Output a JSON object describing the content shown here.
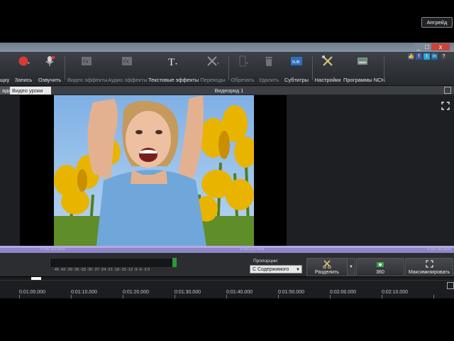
{
  "window": {
    "minimize_glyph": "_",
    "maximize_glyph": "□",
    "close_glyph": "x"
  },
  "toolbar": {
    "items": [
      {
        "label": "щку",
        "icon": "partial-icon"
      },
      {
        "label": "Запись",
        "icon": "record-icon"
      },
      {
        "label": "Озвучить",
        "icon": "microphone-icon"
      },
      {
        "label": "Видео эффекты",
        "icon": "video-fx-icon"
      },
      {
        "label": "Аудио эффекты",
        "icon": "audio-fx-icon"
      },
      {
        "label": "Текстовые эффекты",
        "icon": "text-effects-icon"
      },
      {
        "label": "Переходы",
        "icon": "transitions-icon"
      },
      {
        "label": "Обрезать",
        "icon": "crop-icon"
      },
      {
        "label": "Удалить",
        "icon": "trash-icon"
      },
      {
        "label": "Субтитры",
        "icon": "subtitles-icon"
      },
      {
        "label": "Настройки",
        "icon": "settings-tools-icon"
      },
      {
        "label": "Программы NCH",
        "icon": "nch-programs-icon"
      }
    ],
    "sub_badge": "SUB",
    "upgrade_label": "Апгрейд",
    "social": [
      "like-icon",
      "facebook-icon",
      "twitter-icon",
      "linkedin-icon",
      "help-icon"
    ]
  },
  "tabs": {
    "left_tab": "ада",
    "lessons_tab": "Видео уроки",
    "sequence_title": "Видеоряд 1"
  },
  "scrubber": {
    "times": [
      "0:00:10.000",
      "0:00:20.000",
      "0:00:30.000"
    ]
  },
  "controls": {
    "db_scale": "-45 -42 -39 -36 -33 -30 -27 -24 -21 -18 -15 -12 -9 -6 -3 0",
    "proportions_label": "Пропорции:",
    "proportions_value": "С Содержимого",
    "split_label": "Разделить",
    "vr_label": "360",
    "maximize_label": "Максимизировать"
  },
  "ruler": {
    "times": [
      "0:01:00.000",
      "0:01:10.000",
      "0:01:20.000",
      "0:01:30.000",
      "0:01:40.000",
      "0:01:50.000",
      "0:02:00.000",
      "0:02:10.000"
    ]
  },
  "colors": {
    "accent_scrub": "#8e86c8",
    "record_red": "#d83a32",
    "meter_green": "#2a9a3a"
  }
}
